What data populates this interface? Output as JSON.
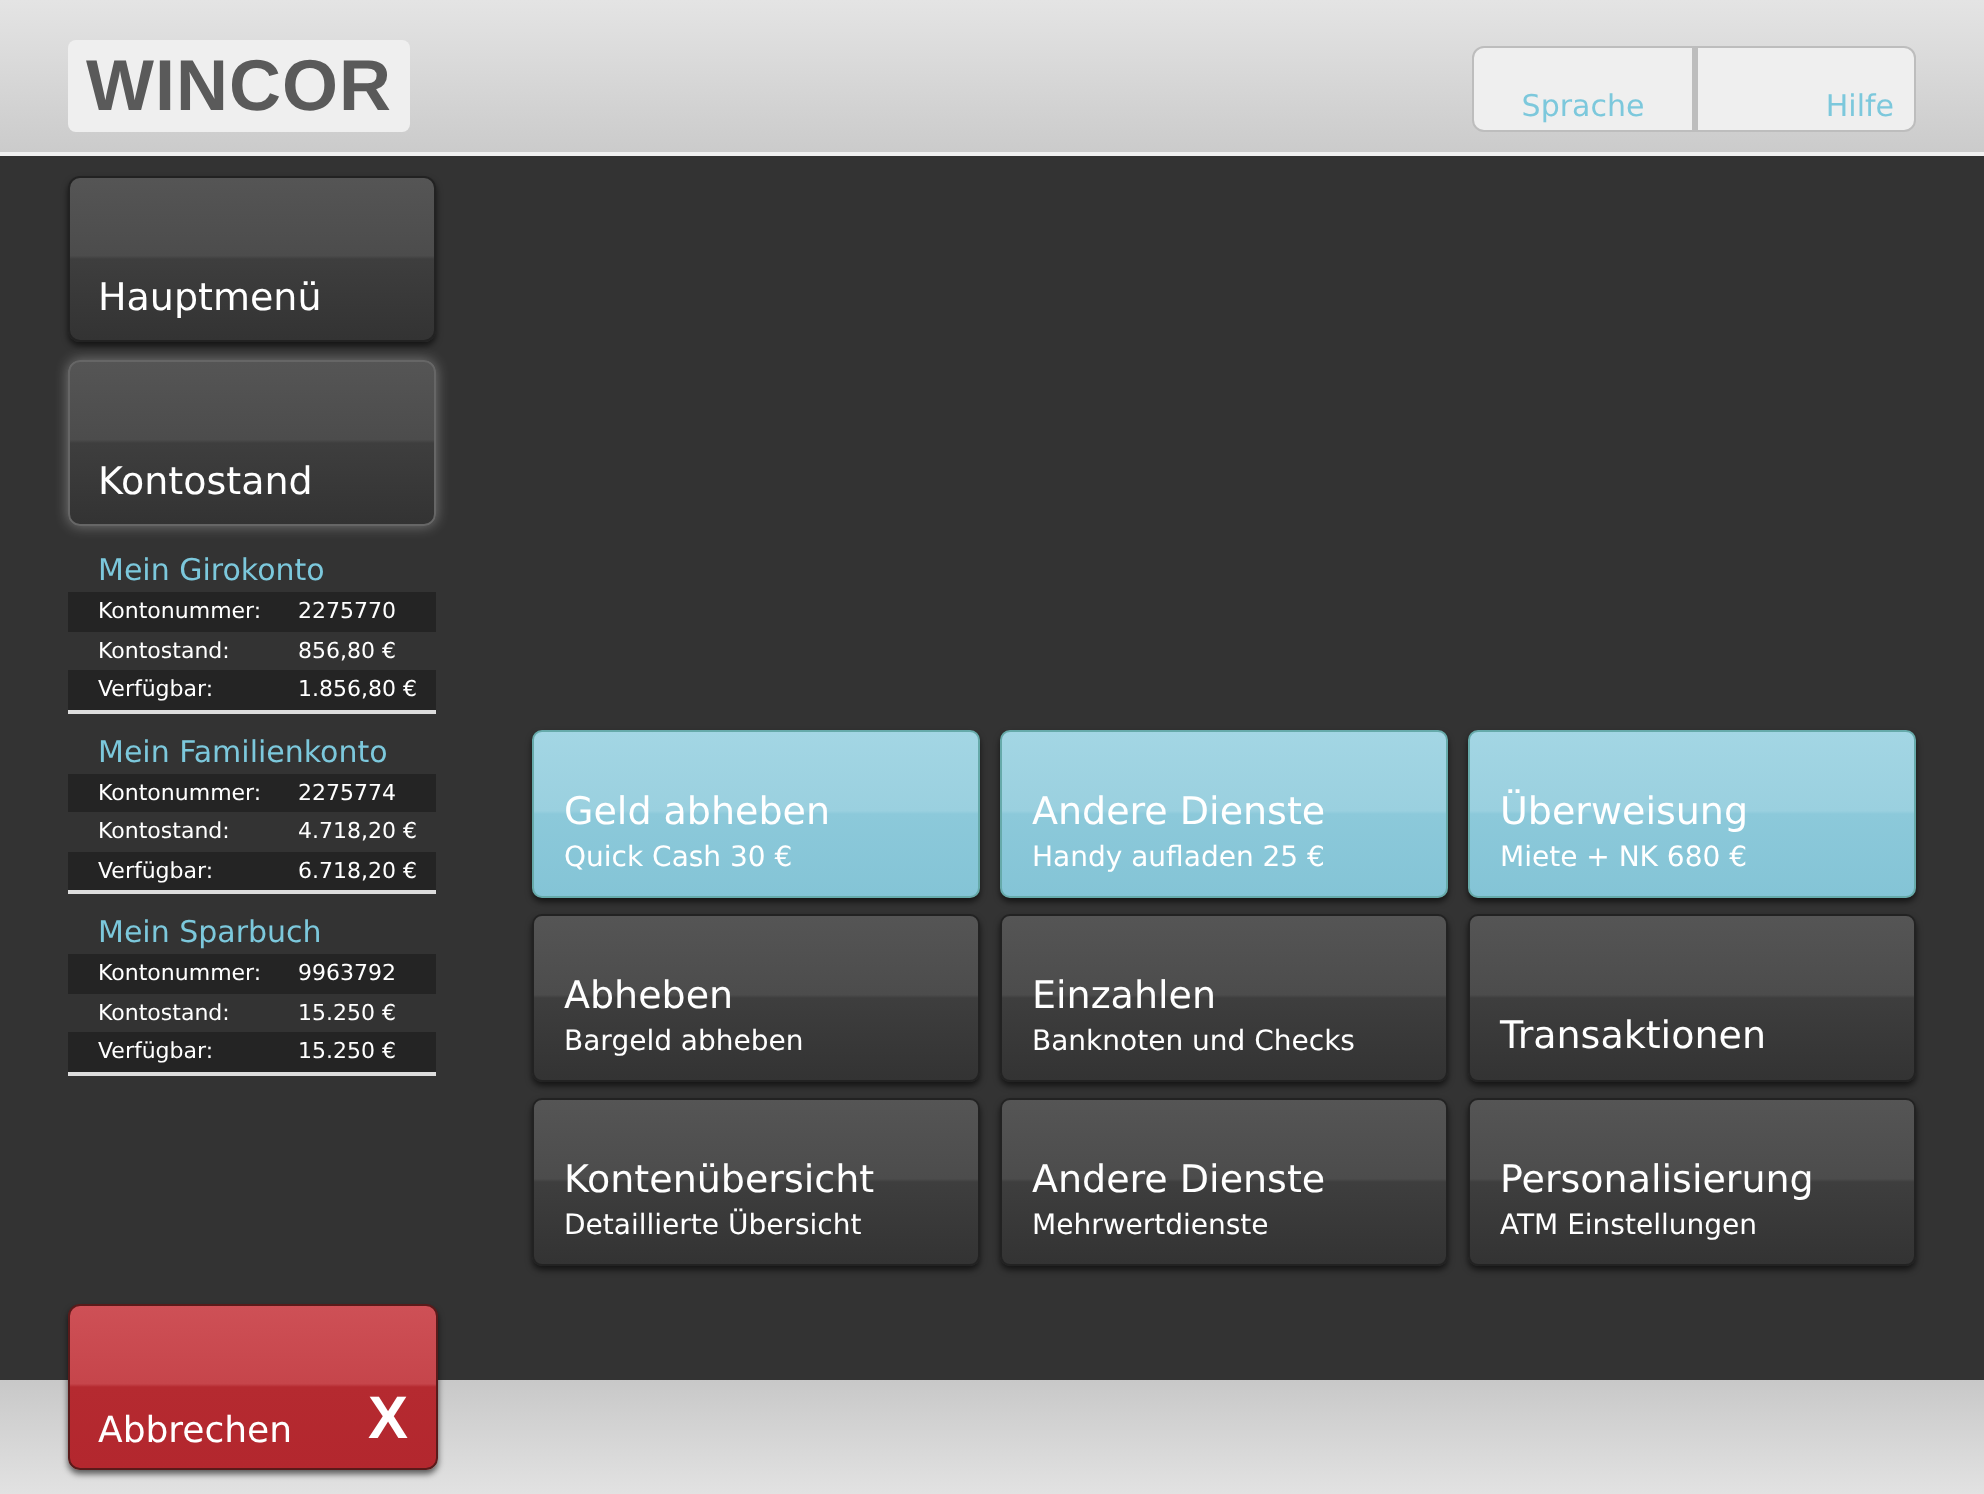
{
  "header": {
    "logo": "WINCOR",
    "buttons": [
      {
        "label": "Sprache"
      },
      {
        "label": "Hilfe"
      }
    ]
  },
  "sidebar": {
    "items": [
      {
        "label": "Hauptmenü",
        "selected": false
      },
      {
        "label": "Kontostand",
        "selected": true
      }
    ],
    "accounts": [
      {
        "name": "Mein Girokonto",
        "rows": [
          {
            "label": "Kontonummer:",
            "value": "2275770"
          },
          {
            "label": "Kontostand:",
            "value": "856,80 €"
          },
          {
            "label": "Verfügbar:",
            "value": "1.856,80 €"
          }
        ]
      },
      {
        "name": "Mein Familienkonto",
        "rows": [
          {
            "label": "Kontonummer:",
            "value": "2275774"
          },
          {
            "label": "Kontostand:",
            "value": "4.718,20 €"
          },
          {
            "label": "Verfügbar:",
            "value": "6.718,20 €"
          }
        ]
      },
      {
        "name": "Mein Sparbuch",
        "rows": [
          {
            "label": "Kontonummer:",
            "value": "9963792"
          },
          {
            "label": "Kontostand:",
            "value": "15.250 €"
          },
          {
            "label": "Verfügbar:",
            "value": "15.250 €"
          }
        ]
      }
    ]
  },
  "tiles": [
    {
      "title": "Geld abheben",
      "subtitle": "Quick Cash 30 €",
      "highlighted": true
    },
    {
      "title": "Andere Dienste",
      "subtitle": "Handy aufladen 25 €",
      "highlighted": true
    },
    {
      "title": "Überweisung",
      "subtitle": "Miete + NK 680 €",
      "highlighted": true
    },
    {
      "title": "Abheben",
      "subtitle": "Bargeld abheben",
      "highlighted": false
    },
    {
      "title": "Einzahlen",
      "subtitle": "Banknoten und Checks",
      "highlighted": false
    },
    {
      "title": "Transaktionen",
      "highlighted": false
    },
    {
      "title": "Kontenübersicht",
      "subtitle": "Detaillierte Übersicht",
      "highlighted": false
    },
    {
      "title": "Andere Dienste",
      "subtitle": "Mehrwertdienste",
      "highlighted": false
    },
    {
      "title": "Personalisierung",
      "subtitle": "ATM Einstellungen",
      "highlighted": false
    }
  ],
  "cancel_button": {
    "label": "Abbrechen",
    "icon_text": "X"
  }
}
